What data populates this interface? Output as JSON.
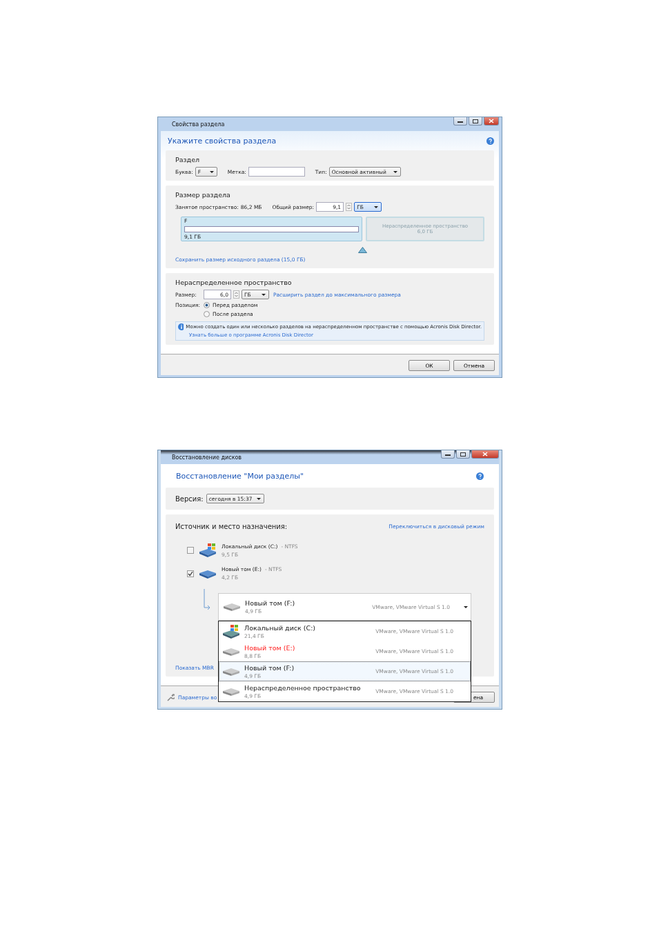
{
  "partition_dialog": {
    "title": "Свойства раздела",
    "heading": "Укажите свойства раздела",
    "partition": {
      "title": "Раздел",
      "letter_label": "Буква:",
      "letter_value": "F",
      "label_label": "Метка:",
      "type_label": "Тип:",
      "type_value": "Основной активный"
    },
    "size": {
      "title": "Размер раздела",
      "used_label": "Занятое пространство:",
      "used_value": "86,2 МБ",
      "total_label": "Общий размер:",
      "total_value": "9,1",
      "unit": "ГБ",
      "bar_letter": "F",
      "bar_size": "9,1 ГБ",
      "unalloc_label": "Нераспределенное пространство",
      "unalloc_size": "6,0 ГБ",
      "keep_link": "Сохранить размер исходного раздела (15,0 ГБ)"
    },
    "unallocated": {
      "title": "Нераспределенное пространство",
      "size_label": "Размер:",
      "size_value": "6,0",
      "unit": "ГБ",
      "expand_link": "Расширить раздел до максимального размера",
      "position_label": "Позиция:",
      "options": [
        {
          "label": "Перед разделом",
          "selected": true
        },
        {
          "label": "После раздела",
          "selected": false
        }
      ],
      "info_text": "Можно создать один или несколько разделов на нераспределенном пространстве с помощью Acronis Disk Director.",
      "info_link": "Узнать больше о программе Acronis Disk Director"
    },
    "buttons": [
      "ОК",
      "Отмена"
    ]
  },
  "recovery_dialog": {
    "title": "Восстановление дисков",
    "heading": "Восстановление \"Мои разделы\"",
    "version_label": "Версия:",
    "version_value": "сегодня в 15:37",
    "source_title": "Источник и место назначения:",
    "switch_link": "Переключиться в дисковый режим",
    "disks": [
      {
        "kind": "windows",
        "name": "Локальный диск (C:)",
        "fs": "- NTFS",
        "size": "9,5 ГБ",
        "checked": false
      },
      {
        "kind": "drive",
        "name": "Новый том (E:)",
        "fs": "- NTFS",
        "size": "4,2 ГБ",
        "checked": true
      }
    ],
    "target": {
      "name": "Новый том (F:)",
      "size": "4,9 ГБ",
      "device": "VMware, VMware Virtual S 1.0"
    },
    "dropdown_items": [
      {
        "kind": "windows",
        "name": "Локальный диск (C:)",
        "size": "21,4 ГБ",
        "device": "VMware, VMware Virtual S 1.0",
        "highlighted": false,
        "selected": false
      },
      {
        "kind": "drive",
        "name": "Новый том (E:)",
        "size": "8,8 ГБ",
        "device": "VMware, VMware Virtual S 1.0",
        "highlighted": true,
        "selected": false
      },
      {
        "kind": "drive",
        "name": "Новый том (F:)",
        "size": "4,9 ГБ",
        "device": "VMware, VMware Virtual S 1.0",
        "highlighted": false,
        "selected": true
      },
      {
        "kind": "drive",
        "name": "Нераспределенное пространство",
        "size": "4,9 ГБ",
        "device": "VMware, VMware Virtual S 1.0",
        "highlighted": false,
        "selected": false
      }
    ],
    "show_mbr_link": "Показать MBR",
    "options_link": "Параметры во",
    "cancel_button": "ена"
  }
}
